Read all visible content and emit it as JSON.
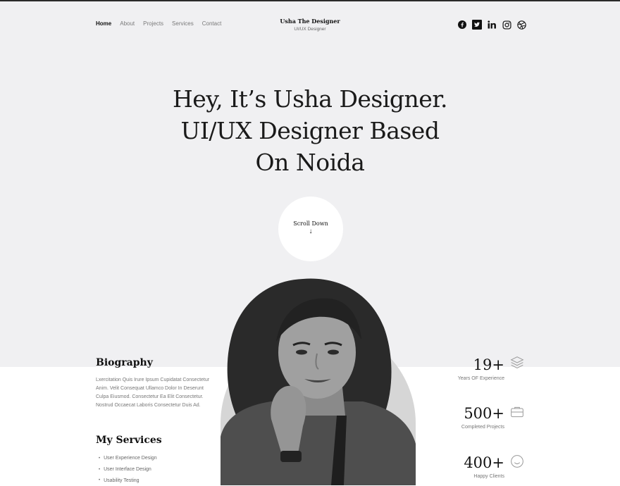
{
  "nav": {
    "items": [
      "Home",
      "About",
      "Projects",
      "Services",
      "Contact"
    ],
    "active": "Home"
  },
  "brand": {
    "name": "Usha The Designer",
    "subtitle": "UI/UX Designer"
  },
  "social": [
    "facebook-icon",
    "twitter-icon",
    "linkedin-icon",
    "instagram-icon",
    "dribbble-icon"
  ],
  "hero": {
    "line1": "Hey, It’s Usha Designer.",
    "line2": "UI/UX Designer Based",
    "line3": "On Noida",
    "scroll_label": "Scroll Down",
    "scroll_arrow": "↓"
  },
  "biography": {
    "title": "Biography",
    "text": "Lxercitation Quis Irure Ipsum Cupidatat Consectetur Anim. Velit Consequat Ullamco Dolor In Deserunt Culpa Eiusmod. Consectetur Ea Elit Consectetur. Nostrud Occaecat Laboris Consectetur Duis Ad."
  },
  "services": {
    "title": "My Services",
    "items": [
      "User Experience Design",
      "User Interface Design",
      "Usability Testing"
    ]
  },
  "stats": [
    {
      "value": "19+",
      "label": "Years OF Experience",
      "icon": "layers-icon"
    },
    {
      "value": "500+",
      "label": "Completed Projects",
      "icon": "briefcase-icon"
    },
    {
      "value": "400+",
      "label": "Happy Clients",
      "icon": "smile-icon"
    }
  ],
  "colors": {
    "hero_bg": "#f0f0f2",
    "text": "#1a1a1a",
    "muted": "#777777",
    "arch": "#d6d6d6"
  }
}
